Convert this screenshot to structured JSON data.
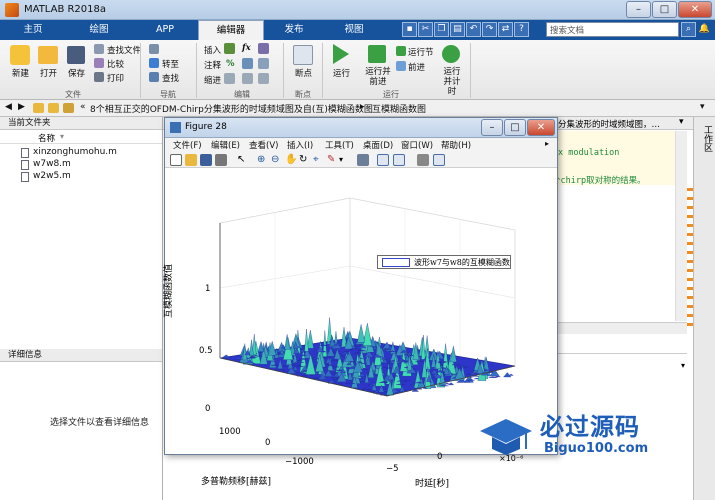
{
  "window": {
    "title": "MATLAB R2018a"
  },
  "tabs": [
    "主页",
    "绘图",
    "APP",
    "编辑器",
    "发布",
    "视图"
  ],
  "search": {
    "placeholder": "搜索文档"
  },
  "ribbon": {
    "new": "新建",
    "open": "打开",
    "save": "保存",
    "find_files": "查找文件",
    "compare": "比较",
    "print": "打印",
    "insert": "插入",
    "comment": "注释",
    "indent": "缩进",
    "goto": "转至",
    "find": "查找",
    "breakpoints": "断点",
    "run": "运行",
    "run_advance": "运行并前进",
    "run_section": "运行节",
    "advance": "前进",
    "run_time": "运行并计时",
    "group_file": "文件",
    "group_nav": "导航",
    "group_edit": "编辑",
    "group_bp": "断点",
    "group_run": "运行",
    "fx": "fx"
  },
  "path": {
    "prefix": "«",
    "segment1": "8个相互正交的OFDM-Chirp分集波形的时域频域图及自(互)模糊函数图",
    "segment2": "互模糊函数图"
  },
  "current_folder": {
    "title": "当前文件夹",
    "col_name": "名称",
    "files": [
      "xinzonghumohu.m",
      "w7w8.m",
      "w2w5.m"
    ]
  },
  "details": {
    "title": "详细信息",
    "empty": "选择文件以查看详细信息"
  },
  "editor": {
    "tab_title": "分集波形的时域频域图，…",
    "line1": "x modulation",
    "line2": "个chirp取对称的结果。"
  },
  "side_tab": "工作区",
  "figure": {
    "title": "Figure 28",
    "menus": [
      "文件(F)",
      "编辑(E)",
      "查看(V)",
      "插入(I)",
      "工具(T)",
      "桌面(D)",
      "窗口(W)",
      "帮助(H)"
    ],
    "legend": "波形w7与w8的互模糊函数",
    "zlabel": "互模糊函数值",
    "ylabel": "多普勒频移[赫兹]",
    "xlabel": "时延[秒]",
    "zticks": [
      "1",
      "0.5",
      "0"
    ],
    "yticks": [
      "1000",
      "0",
      "−1000"
    ],
    "xticks": [
      "−5",
      "0",
      "5"
    ],
    "xexp": "×10⁻⁶"
  },
  "watermark": {
    "brand": "必过源码",
    "url": "Biguo100.com"
  },
  "colors": {
    "matlab_blue": "#16539c",
    "surface_low": "#2b2fc8",
    "surface_high": "#3fd8c0"
  }
}
